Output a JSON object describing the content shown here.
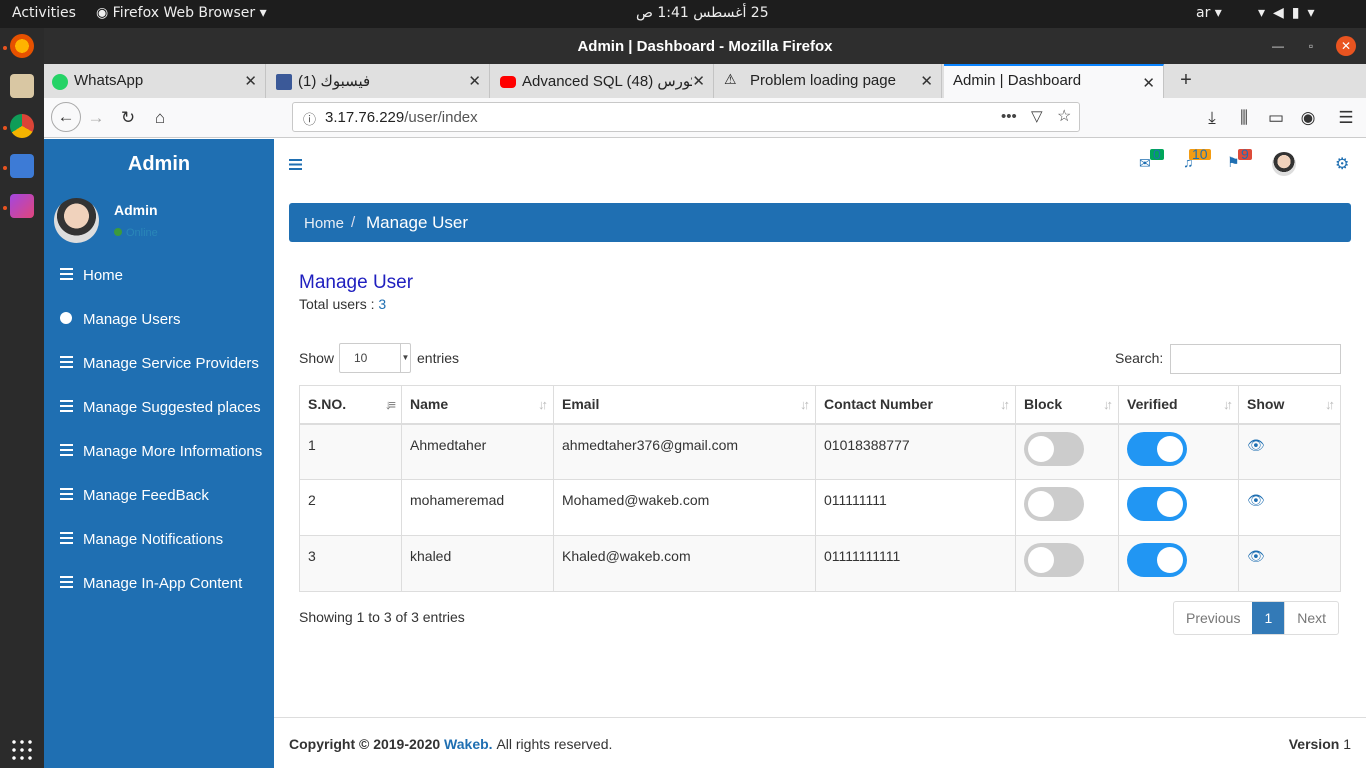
{
  "topbar": {
    "activities": "Activities",
    "app": "Firefox Web Browser",
    "clock": "25 أغسطس  1:41 ص",
    "lang": "ar"
  },
  "window": {
    "title": "Admin | Dashboard - Mozilla Firefox"
  },
  "tabs": [
    {
      "label": "WhatsApp"
    },
    {
      "label": "فيسبوك (1)"
    },
    {
      "label": "Advanced SQL كورس (48)"
    },
    {
      "label": "Problem loading page"
    },
    {
      "label": "Admin | Dashboard"
    }
  ],
  "url": {
    "host": "3.17.76.229",
    "path": "/user/index"
  },
  "sidebar": {
    "brand": "Admin",
    "user": "Admin",
    "status": "Online",
    "items": [
      {
        "label": "Home"
      },
      {
        "label": "Manage Users"
      },
      {
        "label": "Manage Service Providers"
      },
      {
        "label": "Manage Suggested places"
      },
      {
        "label": "Manage More Informations"
      },
      {
        "label": "Manage FeedBack"
      },
      {
        "label": "Manage Notifications"
      },
      {
        "label": "Manage In-App Content"
      }
    ]
  },
  "header": {
    "mail_count": "0",
    "bell_count": "10",
    "flag_count": "9"
  },
  "breadcrumb": {
    "home": "Home",
    "sep": "/",
    "current": "Manage User"
  },
  "page": {
    "title": "Manage User",
    "total_label": "Total users :",
    "total_value": "3"
  },
  "table_controls": {
    "show": "Show",
    "length": "10",
    "entries": "entries",
    "search": "Search:"
  },
  "table": {
    "columns": [
      "S.NO.",
      "Name",
      "Email",
      "Contact Number",
      "Block",
      "Verified",
      "Show"
    ],
    "rows": [
      {
        "sno": "1",
        "name": "Ahmedtaher",
        "email": "ahmedtaher376@gmail.com",
        "contact": "01018388777"
      },
      {
        "sno": "2",
        "name": "mohameremad",
        "email": "Mohamed@wakeb.com",
        "contact": "011111111"
      },
      {
        "sno": "3",
        "name": "khaled",
        "email": "Khaled@wakeb.com",
        "contact": "01111111111"
      }
    ]
  },
  "info": "Showing 1 to 3 of 3 entries",
  "pager": {
    "prev": "Previous",
    "page": "1",
    "next": "Next"
  },
  "footer": {
    "copy": "Copyright © 2019-2020",
    "brand": "Wakeb.",
    "rights": "All rights reserved.",
    "version_label": "Version",
    "version": "1"
  },
  "colors": {
    "primary": "#1f6fb2",
    "toggle_on": "#2196f3",
    "toggle_off": "#cccccc"
  }
}
